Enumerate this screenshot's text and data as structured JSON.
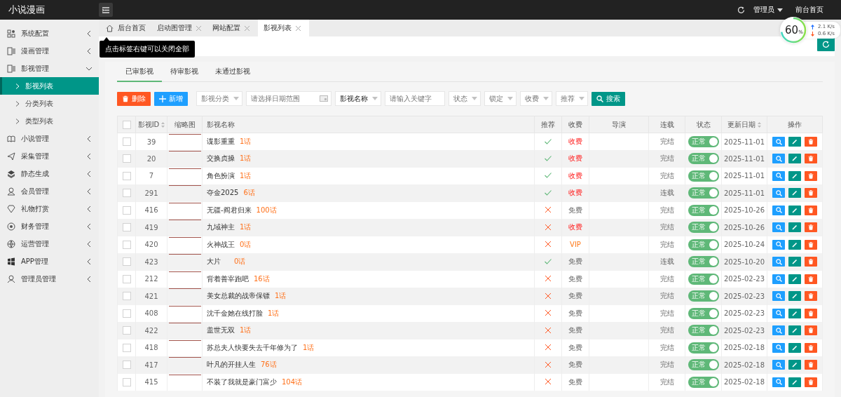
{
  "app": {
    "title": "小说漫画"
  },
  "header": {
    "user": "管理员",
    "front_link": "前台首页"
  },
  "sidebar": {
    "items": [
      {
        "label": "系统配置",
        "expanded": false
      },
      {
        "label": "漫画管理",
        "expanded": false
      },
      {
        "label": "影视管理",
        "expanded": true,
        "children": [
          {
            "label": "影视列表",
            "selected": true
          },
          {
            "label": "分类列表",
            "selected": false
          },
          {
            "label": "类型列表",
            "selected": false
          }
        ]
      },
      {
        "label": "小说管理",
        "expanded": false
      },
      {
        "label": "采集管理",
        "expanded": false
      },
      {
        "label": "静态生成",
        "expanded": false
      },
      {
        "label": "会员管理",
        "expanded": false
      },
      {
        "label": "礼物打赏",
        "expanded": false
      },
      {
        "label": "财务管理",
        "expanded": false
      },
      {
        "label": "运营管理",
        "expanded": false
      },
      {
        "label": "APP管理",
        "expanded": false
      },
      {
        "label": "管理员管理",
        "expanded": false
      }
    ]
  },
  "page_tabs": [
    {
      "label": "后台首页",
      "closable": false,
      "selected": false
    },
    {
      "label": "启动图管理",
      "closable": true,
      "selected": false
    },
    {
      "label": "网站配置",
      "closable": true,
      "selected": false
    },
    {
      "label": "影视列表",
      "closable": true,
      "selected": true
    }
  ],
  "tooltip": "点击标签右键可以关闭全部",
  "speed_meter": {
    "value": "60",
    "unit": "%",
    "upload": "2.1 K/s",
    "download": "0.6 K/s"
  },
  "sub_tabs": [
    {
      "label": "已审影视",
      "selected": true
    },
    {
      "label": "待审影视",
      "selected": false
    },
    {
      "label": "未通过影视",
      "selected": false
    }
  ],
  "toolbar": {
    "buttons": [
      {
        "kind": "delete",
        "label": "删除"
      },
      {
        "kind": "add",
        "label": "新增"
      }
    ],
    "filters": [
      {
        "kind": "select",
        "placeholder": "影视分类"
      },
      {
        "kind": "date",
        "placeholder": "请选择日期范围"
      },
      {
        "kind": "select",
        "value": "影视名称"
      },
      {
        "kind": "text",
        "placeholder": "请输入关键字"
      },
      {
        "kind": "select",
        "placeholder": "状态"
      },
      {
        "kind": "select",
        "placeholder": "锁定"
      },
      {
        "kind": "select",
        "placeholder": "收费"
      },
      {
        "kind": "select",
        "placeholder": "推荐"
      }
    ],
    "search": "搜索"
  },
  "table": {
    "select_all": {
      "checked": false
    },
    "columns": [
      {
        "label": "影视ID",
        "sortable": true
      },
      {
        "label": "缩略图",
        "sortable": false
      },
      {
        "label": "影视名称",
        "sortable": false
      },
      {
        "label": "推荐",
        "sortable": false
      },
      {
        "label": "收费",
        "sortable": false
      },
      {
        "label": "导演",
        "sortable": false
      },
      {
        "label": "连载",
        "sortable": false
      },
      {
        "label": "状态",
        "sortable": false
      },
      {
        "label": "更新日期",
        "sortable": true
      },
      {
        "label": "操作",
        "sortable": false
      }
    ],
    "rows": [
      {
        "checked": false,
        "id": "39",
        "title": "谍影重重",
        "episodes": "1话",
        "recommended": true,
        "fee": "收费",
        "color": "#ff2222",
        "serial": "完结",
        "status": "正常",
        "status_on": true,
        "updated": "2025-11-01"
      },
      {
        "checked": false,
        "id": "20",
        "title": "交换贞操",
        "episodes": "1话",
        "recommended": true,
        "fee": "收费",
        "color": "#ff2222",
        "serial": "完结",
        "status": "正常",
        "status_on": true,
        "updated": "2025-11-01"
      },
      {
        "checked": false,
        "id": "7",
        "title": "角色扮演",
        "episodes": "1话",
        "recommended": true,
        "fee": "收费",
        "color": "#ff2222",
        "serial": "完结",
        "status": "正常",
        "status_on": true,
        "updated": "2025-11-01"
      },
      {
        "checked": false,
        "id": "291",
        "title": "夺金2025",
        "episodes": "6话",
        "recommended": true,
        "fee": "收费",
        "color": "#ff2222",
        "serial": "连载",
        "status": "正常",
        "status_on": true,
        "updated": "2025-11-01"
      },
      {
        "checked": false,
        "id": "416",
        "title": "无疆-阎君归来",
        "episodes": "100话",
        "recommended": false,
        "fee": "免费",
        "serial": "完结",
        "status": "正常",
        "status_on": true,
        "updated": "2025-10-26"
      },
      {
        "checked": false,
        "id": "419",
        "title": "九域神主",
        "episodes": "1话",
        "recommended": false,
        "fee": "收费",
        "color": "#ff2222",
        "serial": "完结",
        "status": "正常",
        "status_on": true,
        "updated": "2025-10-26"
      },
      {
        "checked": false,
        "id": "420",
        "title": "火神战王",
        "episodes": "0话",
        "recommended": false,
        "fee": "VIP",
        "color": "#ff7a1a",
        "serial": "完结",
        "status": "正常",
        "status_on": true,
        "updated": "2025-10-24"
      },
      {
        "checked": false,
        "id": "423",
        "title": "大片",
        "episodes": "0话",
        "recommended": true,
        "fee": "免费",
        "serial": "连载",
        "status": "正常",
        "status_on": true,
        "updated": "2025-10-20"
      },
      {
        "checked": false,
        "id": "212",
        "title": "背着善宰跑吧",
        "episodes": "16话",
        "recommended": false,
        "fee": "免费",
        "serial": "完结",
        "status": "正常",
        "status_on": true,
        "updated": "2025-02-23"
      },
      {
        "checked": false,
        "id": "421",
        "title": "美女总裁的战帝保镖",
        "episodes": "1话",
        "recommended": false,
        "fee": "免费",
        "serial": "完结",
        "status": "正常",
        "status_on": true,
        "updated": "2025-02-23"
      },
      {
        "checked": false,
        "id": "408",
        "title": "沈千金她在线打脸",
        "episodes": "1话",
        "recommended": false,
        "fee": "免费",
        "serial": "完结",
        "status": "正常",
        "status_on": true,
        "updated": "2025-02-23"
      },
      {
        "checked": false,
        "id": "422",
        "title": "盖世无双",
        "episodes": "1话",
        "recommended": false,
        "fee": "免费",
        "serial": "完结",
        "status": "正常",
        "status_on": true,
        "updated": "2025-02-23"
      },
      {
        "checked": false,
        "id": "418",
        "title": "苏总夫人快要失去千年修为了",
        "episodes": "1话",
        "recommended": false,
        "fee": "免费",
        "serial": "完结",
        "status": "正常",
        "status_on": true,
        "updated": "2025-02-18"
      },
      {
        "checked": false,
        "id": "417",
        "title": "叶凡的开挂人生",
        "episodes": "76话",
        "recommended": false,
        "fee": "免费",
        "serial": "完结",
        "status": "正常",
        "status_on": true,
        "updated": "2025-02-18"
      },
      {
        "checked": false,
        "id": "415",
        "title": "不装了我就是豪门富少",
        "episodes": "104话",
        "recommended": false,
        "fee": "免费",
        "serial": "完结",
        "status": "正常",
        "status_on": true,
        "updated": "2025-02-18"
      }
    ]
  }
}
